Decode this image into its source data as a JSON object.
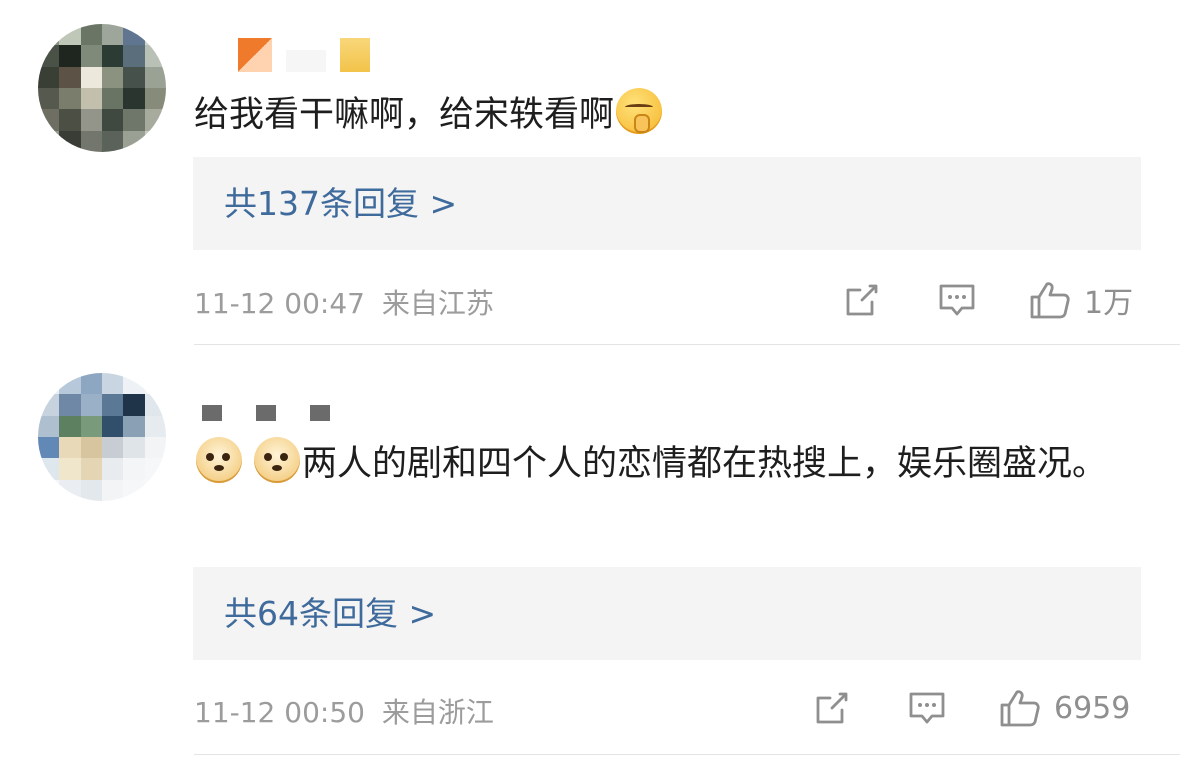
{
  "comments": [
    {
      "text": "给我看干嘛啊，给宋轶看啊",
      "emoji_after": "shush-face-emoji",
      "replies_label": "共137条回复 >",
      "timestamp": "11-12 00:47",
      "location": "来自江苏",
      "likes": "1万"
    },
    {
      "emoji_before": [
        "doge-emoji",
        "doge-emoji"
      ],
      "text": "两人的剧和四个人的恋情都在热搜上，娱乐圈盛况。",
      "replies_label": "共64条回复 >",
      "timestamp": "11-12 00:50",
      "location": "来自浙江",
      "likes": "6959"
    }
  ],
  "icons": {
    "share": "share-icon",
    "comment": "comment-icon",
    "like": "thumbs-up-icon"
  },
  "colors": {
    "reply_link": "#3f6a9c",
    "reply_box_bg": "#f4f4f4",
    "meta_gray": "#9c9c9c",
    "body_text": "#1e1e1e"
  }
}
